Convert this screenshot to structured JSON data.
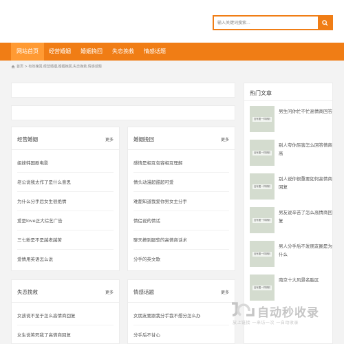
{
  "search": {
    "placeholder": "输入关键词搜索..."
  },
  "nav": [
    "网站首页",
    "经营婚姻",
    "婚姻挽回",
    "失恋挽救",
    "情感话题"
  ],
  "breadcrumb": "首页 > 有效挽回,经营婚姻,婚姻挽回,失恋挽救,情感话题",
  "panels": [
    {
      "title": "经营婚姻",
      "more": "更多",
      "items": [
        "姐妹韩国剧电影",
        "老公说我太作了是什么意思",
        "为什么分手后女生很绝情",
        "爱是love正大综艺广告",
        "三七粉是不是越老越苦",
        "爱情用英语怎么说"
      ]
    },
    {
      "title": "婚姻挽回",
      "more": "更多",
      "items": [
        "感情是相互包容相互理解",
        "情头动漫超甜超可爱",
        "难都知道我爱你男女主分手",
        "情侣说的情话",
        "聊天撩到腿软的高情商话术",
        "分手的英文歌"
      ]
    },
    {
      "title": "失恋挽救",
      "more": "更多",
      "items": [
        "女孩说不至于怎么高情商回复",
        "女生说笑死我了高情商回复"
      ]
    },
    {
      "title": "情感话题",
      "more": "更多",
      "items": [
        "女朋友要跟我分手我不想分怎么办",
        "分手后不甘心"
      ]
    }
  ],
  "hot": {
    "title": "热门文章",
    "thumb_text": "没有图一样精彩",
    "items": [
      "男生问你忙不忙高情商回答",
      "别人夸你厉害怎么回答情商高",
      "别人说你很重要如何高情商回复",
      "男友说辛苦了怎么高情商回复",
      "男人分手后不发朋友圈是为什么",
      "南京十大风景名胜区"
    ]
  },
  "watermark": {
    "title": "自动秒收录",
    "sub": "放上链接 一来访一次 一自动收录"
  }
}
